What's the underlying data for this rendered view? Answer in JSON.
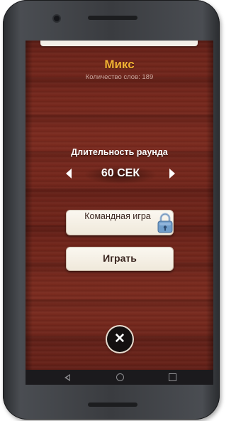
{
  "game": {
    "title": "Микс",
    "word_count": "Количество слов: 189"
  },
  "round": {
    "label": "Длительность раунда",
    "value": "60 СЕК"
  },
  "buttons": {
    "team_game": "Командная игра",
    "team_game_locked": true,
    "play": "Играть",
    "close": "✕"
  },
  "icons": {
    "prev": "chevron-left-icon",
    "next": "chevron-right-icon",
    "lock": "lock-icon",
    "close": "close-icon",
    "nav_back": "back-icon",
    "nav_home": "home-icon",
    "nav_recent": "recent-apps-icon"
  },
  "colors": {
    "title": "#f2b233",
    "wood": "#6b231a",
    "button_bg": "#fbf8f1",
    "lock_blue": "#6f9cc9"
  }
}
